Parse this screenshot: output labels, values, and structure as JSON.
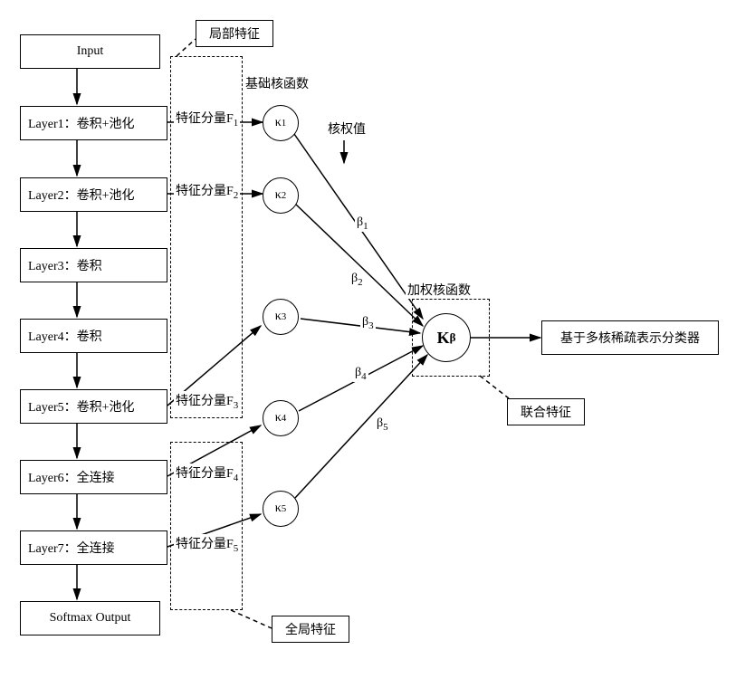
{
  "boxes": {
    "input": "Input",
    "layer1": "Layer1：卷积+池化",
    "layer2": "Layer2：卷积+池化",
    "layer3": "Layer3：卷积",
    "layer4": "Layer4：卷积",
    "layer5": "Layer5：卷积+池化",
    "layer6": "Layer6：全连接",
    "layer7": "Layer7：全连接",
    "output": "Softmax Output",
    "classifier": "基于多核稀疏表示分类器"
  },
  "annotations": {
    "local_feat": "局部特征",
    "global_feat": "全局特征",
    "basis_kernel": "基础核函数",
    "kernel_weight": "核权值",
    "weighted_kernel": "加权核函数",
    "joint_feat": "联合特征"
  },
  "features": {
    "f1": {
      "pre": "特征分量F",
      "sub": "1"
    },
    "f2": {
      "pre": "特征分量F",
      "sub": "2"
    },
    "f3": {
      "pre": "特征分量F",
      "sub": "3"
    },
    "f4": {
      "pre": "特征分量F",
      "sub": "4"
    },
    "f5": {
      "pre": "特征分量F",
      "sub": "5"
    }
  },
  "kernels": {
    "k1": {
      "pre": "κ",
      "sub": "1"
    },
    "k2": {
      "pre": "κ",
      "sub": "2"
    },
    "k3": {
      "pre": "κ",
      "sub": "3"
    },
    "k4": {
      "pre": "κ",
      "sub": "4"
    },
    "k5": {
      "pre": "κ",
      "sub": "5"
    },
    "kb": {
      "pre": "K",
      "sub": "β"
    }
  },
  "betas": {
    "b1": {
      "pre": "β",
      "sub": "1"
    },
    "b2": {
      "pre": "β",
      "sub": "2"
    },
    "b3": {
      "pre": "β",
      "sub": "3"
    },
    "b4": {
      "pre": "β",
      "sub": "4"
    },
    "b5": {
      "pre": "β",
      "sub": "5"
    }
  },
  "chart_data": {
    "type": "diagram",
    "title": "CNN层级特征经多核稀疏表示分类",
    "cnn_layers": [
      {
        "name": "Input",
        "op": "输入"
      },
      {
        "name": "Layer1",
        "op": "卷积+池化",
        "feature": "F1"
      },
      {
        "name": "Layer2",
        "op": "卷积+池化",
        "feature": "F2"
      },
      {
        "name": "Layer3",
        "op": "卷积"
      },
      {
        "name": "Layer4",
        "op": "卷积"
      },
      {
        "name": "Layer5",
        "op": "卷积+池化",
        "feature": "F3"
      },
      {
        "name": "Layer6",
        "op": "全连接",
        "feature": "F4"
      },
      {
        "name": "Layer7",
        "op": "全连接",
        "feature": "F5"
      },
      {
        "name": "Softmax Output",
        "op": "输出"
      }
    ],
    "feature_groups": {
      "局部特征": [
        "F1",
        "F2",
        "F3"
      ],
      "全局特征": [
        "F4",
        "F5"
      ]
    },
    "basis_kernels": [
      "κ1",
      "κ2",
      "κ3",
      "κ4",
      "κ5"
    ],
    "kernel_weights": [
      "β1",
      "β2",
      "β3",
      "β4",
      "β5"
    ],
    "combined_kernel": "Kβ",
    "annotation": "联合特征 → 加权核函数 → 基于多核稀疏表示分类器"
  }
}
